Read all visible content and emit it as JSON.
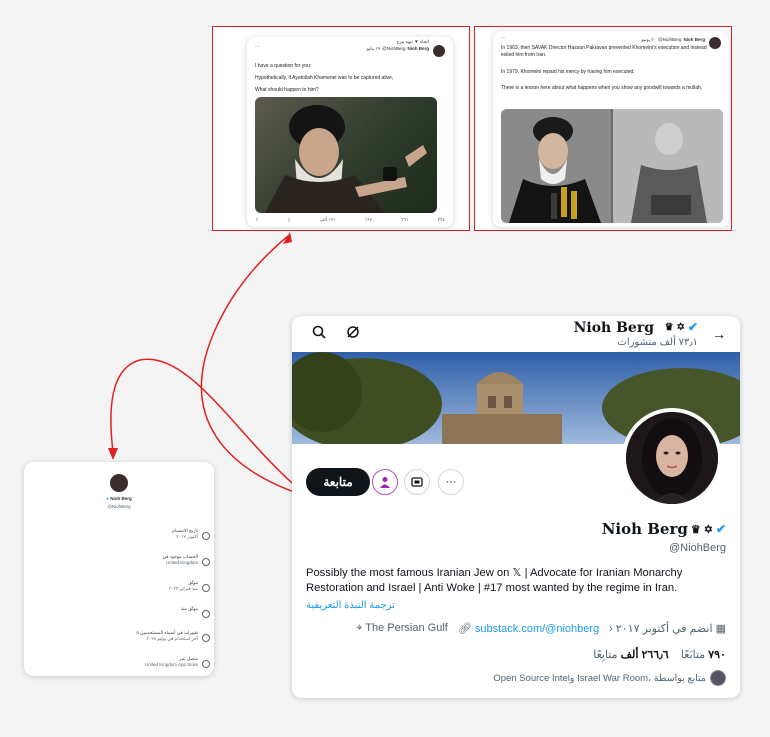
{
  "tweet_left": {
    "header_right": "انجاه ▼ نيوه بيرج",
    "author": "Nioh Berg",
    "handle": "@NiohBerg",
    "time": "١٩ مايو",
    "line1": "I have a question for you:",
    "line2": "Hypothetically, if Ayatollah Khamenei was to be captured alive,",
    "line3": "What should happen to him?",
    "actions": [
      "١٩١ ألف",
      "١٩٧",
      "٢٦١",
      "٣٣٤",
      "ألف"
    ]
  },
  "tweet_right": {
    "author": "Nioh Berg",
    "handle": "@NiohBerg",
    "time": "٢٠ يونيو",
    "line1": "In 1963, then SAVAK Director Hassan Pakravan prevented Khomeini's execution and instead exiled him from Iran.",
    "line2": "In 1979, Khomeini repaid his mercy by having him executed.",
    "line3": "There is a lesson here about what happens when you show any goodwill towards a mullah."
  },
  "profile": {
    "name": "Nioh Berg",
    "posts": "٧٣٫١ ألف منشورات",
    "handle": "@NiohBerg",
    "follow_label": "متابعة",
    "bio": "Possibly the most famous Iranian Jew on 𝕏 | Advocate for Iranian Monarchy Restoration and Israel | Anti Woke | #17 most wanted by the regime in Iran.",
    "translate": "ترجمة النبذة التعريفية",
    "joined": "انضم في أكتوبر ٢٠١٧",
    "website": "substack.com/@niohberg",
    "location": "The Persian Gulf",
    "following_num": "٧٩٠",
    "following_label": "متابَعًا",
    "followers_num": "٢٦٦٫٦ ألف",
    "followers_label": "متابِعًا",
    "followed_by": "Open Source Intelو Israel War Room، متابع بواسطة"
  },
  "about": {
    "name": "Nioh Berg",
    "handle": "@NiohBerg",
    "rows": [
      {
        "title": "تاريخ الانضمام",
        "sub": "أكتوبر ٢٠١٧"
      },
      {
        "title": "الحساب موجود في",
        "sub": "United Kingdom"
      },
      {
        "title": "موثّق",
        "sub": "منذ فبراير ٢٠٢٣"
      },
      {
        "title": "موثّق منذ",
        "sub": ""
      },
      {
        "title": "تغييرات في أسماء المستخدمين ٥",
        "sub": "آخر استخدام في يوليو ٢٠٢٤"
      },
      {
        "title": "متصل عبر",
        "sub": "United Kingdom App Store"
      }
    ]
  },
  "colors": {
    "annotation_red": "#e02020",
    "link_blue": "#1d9bf0",
    "verified_blue": "#1d9bf0"
  }
}
